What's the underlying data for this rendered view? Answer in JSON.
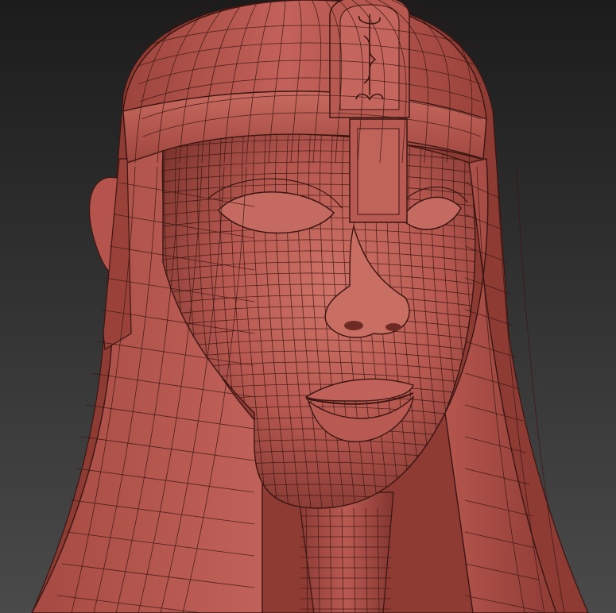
{
  "scene": {
    "subject": "wireframe-helmeted-head",
    "colors": {
      "background_top": "#1c1c1c",
      "background_bottom": "#4a4a4a",
      "clay_light": "#c9685c",
      "clay_mid": "#b2524a",
      "clay_dark": "#7a322c",
      "clay_shadow": "#5a2420",
      "wire": "#3a1612"
    }
  }
}
